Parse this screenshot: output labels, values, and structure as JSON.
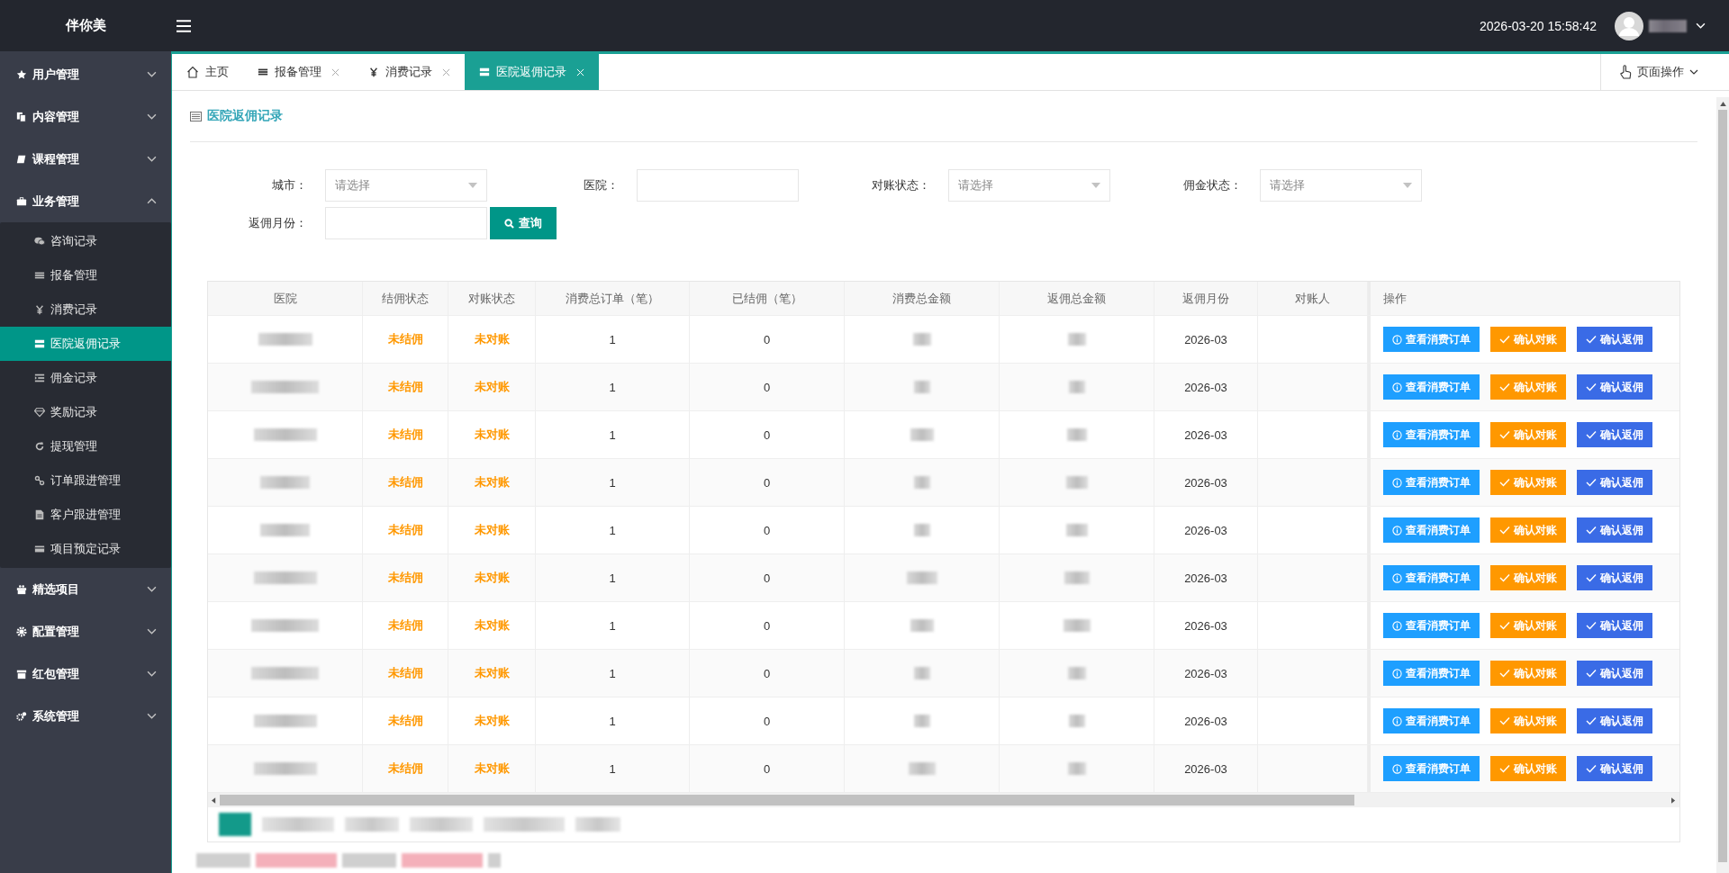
{
  "header": {
    "logo": "伴你美",
    "datetime": "2026-03-20 15:58:42"
  },
  "sidebar": {
    "items": [
      {
        "label": "用户管理",
        "expanded": false,
        "selected": false
      },
      {
        "label": "内容管理",
        "expanded": false,
        "selected": false
      },
      {
        "label": "课程管理",
        "expanded": false,
        "selected": false
      },
      {
        "label": "业务管理",
        "expanded": true,
        "selected": false,
        "children": [
          {
            "label": "咨询记录",
            "selected": false
          },
          {
            "label": "报备管理",
            "selected": false
          },
          {
            "label": "消费记录",
            "selected": false
          },
          {
            "label": "医院返佣记录",
            "selected": true
          },
          {
            "label": "佣金记录",
            "selected": false
          },
          {
            "label": "奖励记录",
            "selected": false
          },
          {
            "label": "提现管理",
            "selected": false
          },
          {
            "label": "订单跟进管理",
            "selected": false
          },
          {
            "label": "客户跟进管理",
            "selected": false
          },
          {
            "label": "项目预定记录",
            "selected": false
          }
        ]
      },
      {
        "label": "精选项目",
        "expanded": false,
        "selected": false
      },
      {
        "label": "配置管理",
        "expanded": false,
        "selected": false
      },
      {
        "label": "红包管理",
        "expanded": false,
        "selected": false
      },
      {
        "label": "系统管理",
        "expanded": false,
        "selected": false
      }
    ]
  },
  "tabs": [
    {
      "label": "主页",
      "selected": false,
      "closable": false
    },
    {
      "label": "报备管理",
      "selected": false,
      "closable": true
    },
    {
      "label": "消费记录",
      "selected": false,
      "closable": true
    },
    {
      "label": "医院返佣记录",
      "selected": true,
      "closable": true
    }
  ],
  "page_actions": {
    "label": "页面操作"
  },
  "page_title": "医院返佣记录",
  "filters": [
    {
      "label": "城市：",
      "kind": "select",
      "placeholder": "请选择"
    },
    {
      "label": "医院：",
      "kind": "input"
    },
    {
      "label": "对账状态：",
      "kind": "select",
      "placeholder": "请选择"
    },
    {
      "label": "佣金状态：",
      "kind": "select",
      "placeholder": "请选择"
    },
    {
      "label": "返佣月份：",
      "kind": "input"
    }
  ],
  "search_button": "查询",
  "table": {
    "columns": [
      "医院",
      "结佣状态",
      "对账状态",
      "消费总订单（笔）",
      "已结佣（笔）",
      "消费总金额",
      "返佣总金额",
      "返佣月份",
      "对账人",
      "操作"
    ],
    "rows": [
      {
        "settle_status": "未结佣",
        "reconcile_status": "未对账",
        "orders": "1",
        "settled": "0",
        "month": "2026-03",
        "actions": [
          {
            "label": "查看消费订单",
            "kind": "view"
          },
          {
            "label": "确认对账",
            "kind": "reconcile"
          },
          {
            "label": "确认返佣",
            "kind": "commission"
          }
        ]
      },
      {
        "settle_status": "未结佣",
        "reconcile_status": "未对账",
        "orders": "1",
        "settled": "0",
        "month": "2026-03",
        "actions": [
          {
            "label": "查看消费订单",
            "kind": "view"
          },
          {
            "label": "确认对账",
            "kind": "reconcile"
          },
          {
            "label": "确认返佣",
            "kind": "commission"
          }
        ]
      },
      {
        "settle_status": "未结佣",
        "reconcile_status": "未对账",
        "orders": "1",
        "settled": "0",
        "month": "2026-03",
        "actions": [
          {
            "label": "查看消费订单",
            "kind": "view"
          },
          {
            "label": "确认对账",
            "kind": "reconcile"
          },
          {
            "label": "确认返佣",
            "kind": "commission"
          }
        ]
      },
      {
        "settle_status": "未结佣",
        "reconcile_status": "未对账",
        "orders": "1",
        "settled": "0",
        "month": "2026-03",
        "actions": [
          {
            "label": "查看消费订单",
            "kind": "view"
          },
          {
            "label": "确认对账",
            "kind": "reconcile"
          },
          {
            "label": "确认返佣",
            "kind": "commission"
          }
        ]
      },
      {
        "settle_status": "未结佣",
        "reconcile_status": "未对账",
        "orders": "1",
        "settled": "0",
        "month": "2026-03",
        "actions": [
          {
            "label": "查看消费订单",
            "kind": "view"
          },
          {
            "label": "确认对账",
            "kind": "reconcile"
          },
          {
            "label": "确认返佣",
            "kind": "commission"
          }
        ]
      },
      {
        "settle_status": "未结佣",
        "reconcile_status": "未对账",
        "orders": "1",
        "settled": "0",
        "month": "2026-03",
        "actions": [
          {
            "label": "查看消费订单",
            "kind": "view"
          },
          {
            "label": "确认对账",
            "kind": "reconcile"
          },
          {
            "label": "确认返佣",
            "kind": "commission"
          }
        ]
      },
      {
        "settle_status": "未结佣",
        "reconcile_status": "未对账",
        "orders": "1",
        "settled": "0",
        "month": "2026-03",
        "actions": [
          {
            "label": "查看消费订单",
            "kind": "view"
          },
          {
            "label": "确认对账",
            "kind": "reconcile"
          },
          {
            "label": "确认返佣",
            "kind": "commission"
          }
        ]
      },
      {
        "settle_status": "未结佣",
        "reconcile_status": "未对账",
        "orders": "1",
        "settled": "0",
        "month": "2026-03",
        "actions": [
          {
            "label": "查看消费订单",
            "kind": "view"
          },
          {
            "label": "确认对账",
            "kind": "reconcile"
          },
          {
            "label": "确认返佣",
            "kind": "commission"
          }
        ]
      },
      {
        "settle_status": "未结佣",
        "reconcile_status": "未对账",
        "orders": "1",
        "settled": "0",
        "month": "2026-03",
        "actions": [
          {
            "label": "查看消费订单",
            "kind": "view"
          },
          {
            "label": "确认对账",
            "kind": "reconcile"
          },
          {
            "label": "确认返佣",
            "kind": "commission"
          }
        ]
      },
      {
        "settle_status": "未结佣",
        "reconcile_status": "未对账",
        "orders": "1",
        "settled": "0",
        "month": "2026-03",
        "actions": [
          {
            "label": "查看消费订单",
            "kind": "view"
          },
          {
            "label": "确认对账",
            "kind": "reconcile"
          },
          {
            "label": "确认返佣",
            "kind": "commission"
          }
        ]
      }
    ]
  }
}
